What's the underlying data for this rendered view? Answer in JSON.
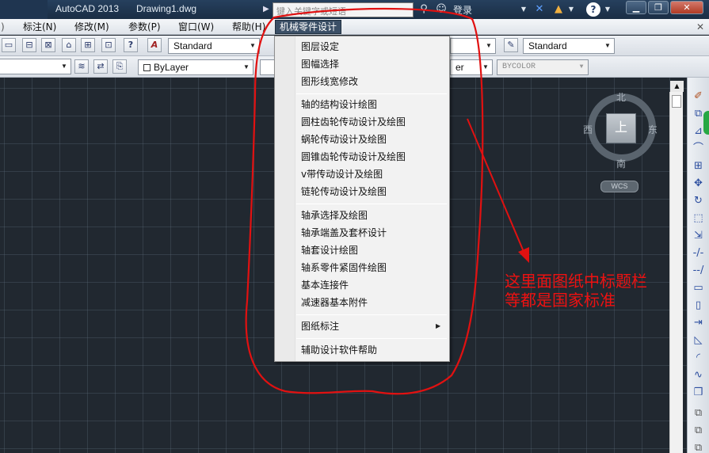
{
  "titlebar": {
    "app_title": "AutoCAD 2013",
    "file_name": "Drawing1.dwg",
    "search_placeholder": "键入关键字或短语",
    "login_label": "登录",
    "icons": [
      "binoculars-icon",
      "user-icon",
      "exchange-icon",
      "a360-icon",
      "help-icon"
    ],
    "help_glyph": "?",
    "buttons": {
      "minimize": "▁",
      "maximize": "❐",
      "close": "✕"
    }
  },
  "menubar": {
    "items": [
      {
        "label": "标注(N)"
      },
      {
        "label": "修改(M)"
      },
      {
        "label": "参数(P)"
      },
      {
        "label": "窗口(W)"
      },
      {
        "label": "帮助(H)"
      }
    ],
    "active_item": "机械零件设计"
  },
  "toolbar1": {
    "text_style": "Standard",
    "right_style": "Standard"
  },
  "toolbar2": {
    "color_combo": "ByLayer",
    "right_partial": "er",
    "plot_style": "BYCOLOR"
  },
  "viewcube": {
    "face": "上",
    "north": "北",
    "south": "南",
    "east": "东",
    "west": "西",
    "wcs_label": "WCS"
  },
  "dropdown": {
    "groups": [
      [
        "图层设定",
        "图幅选择",
        "图形线宽修改"
      ],
      [
        "轴的结构设计绘图",
        "圆柱齿轮传动设计及绘图",
        "蜗轮传动设计及绘图",
        "圆锥齿轮传动设计及绘图",
        "v带传动设计及绘图",
        "链轮传动设计及绘图"
      ],
      [
        "轴承选择及绘图",
        "轴承端盖及套杯设计",
        "轴套设计绘图",
        "轴系零件紧固件绘图",
        "基本连接件",
        "减速器基本附件"
      ],
      [
        "图纸标注"
      ],
      [
        "辅助设计软件帮助"
      ]
    ]
  },
  "annotation": {
    "line1": "这里面图纸中标题栏",
    "line2": "等都是国家标准",
    "color": "#e11111"
  }
}
